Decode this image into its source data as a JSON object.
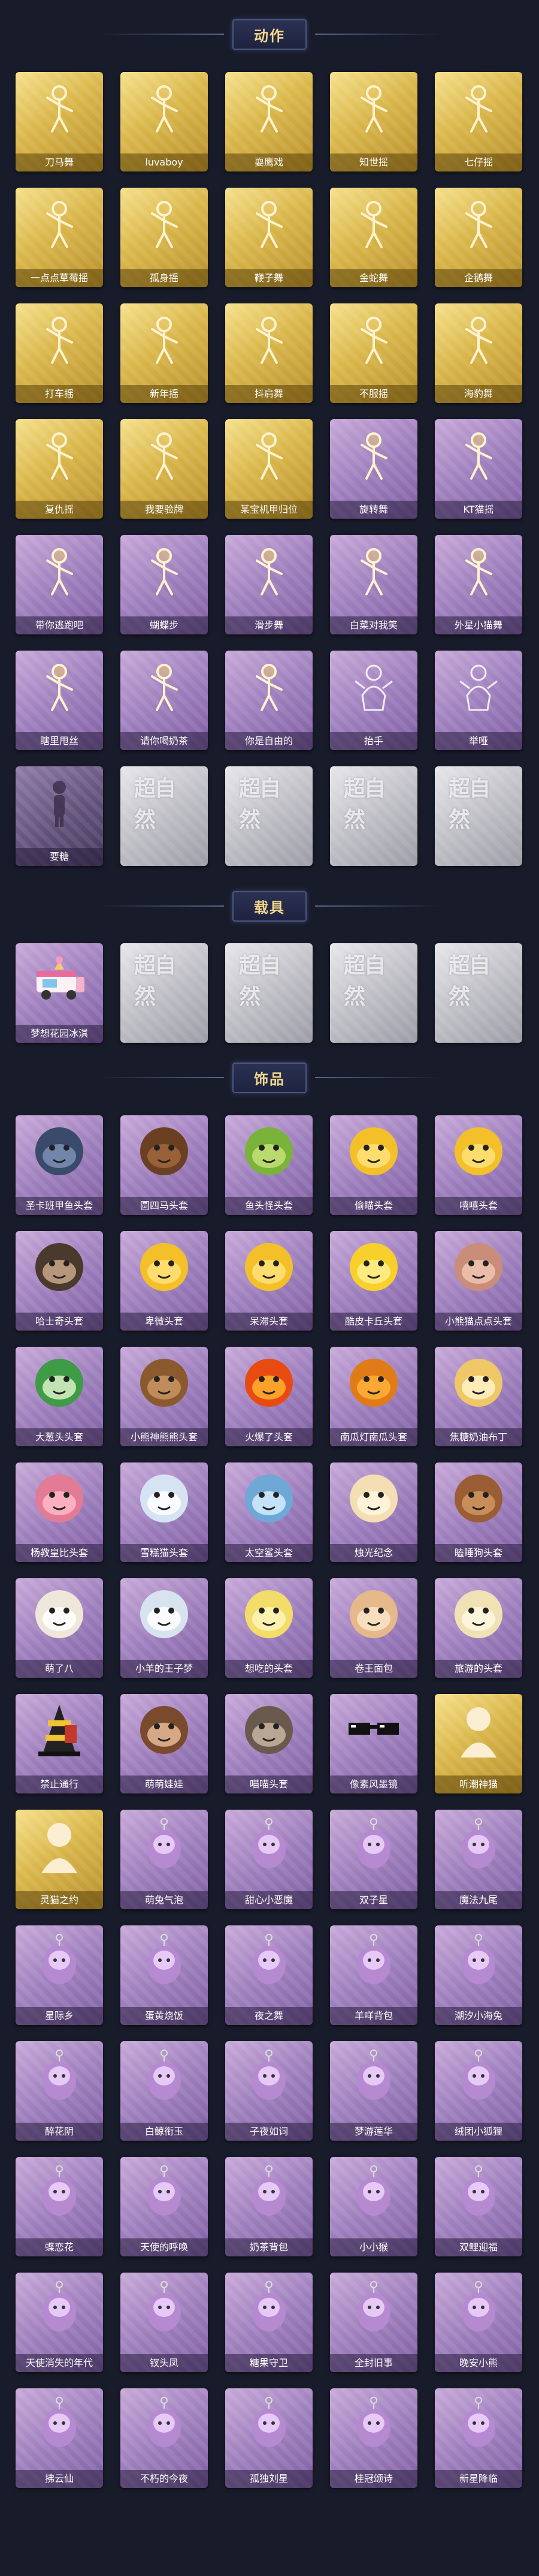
{
  "sections": [
    {
      "title": "动作",
      "items": [
        {
          "label": "刀马舞",
          "rarity": "gold",
          "icon": "dance-pose-icon"
        },
        {
          "label": "luvaboy",
          "rarity": "gold",
          "icon": "dance-pose-icon"
        },
        {
          "label": "耍鹰戏",
          "rarity": "gold",
          "icon": "dance-pose-icon"
        },
        {
          "label": "知世摇",
          "rarity": "gold",
          "icon": "dance-pose-icon"
        },
        {
          "label": "七仔摇",
          "rarity": "gold",
          "icon": "dance-pose-icon"
        },
        {
          "label": "一点点草莓摇",
          "rarity": "gold",
          "icon": "dance-pose-icon"
        },
        {
          "label": "孤身摇",
          "rarity": "gold",
          "icon": "dance-pose-icon"
        },
        {
          "label": "鞭子舞",
          "rarity": "gold",
          "icon": "dance-pose-icon"
        },
        {
          "label": "金蛇舞",
          "rarity": "gold",
          "icon": "dance-pose-icon"
        },
        {
          "label": "企鹅舞",
          "rarity": "gold",
          "icon": "dance-pose-icon"
        },
        {
          "label": "打车摇",
          "rarity": "gold",
          "icon": "dance-pose-icon"
        },
        {
          "label": "新年摇",
          "rarity": "gold",
          "icon": "dance-pose-icon"
        },
        {
          "label": "抖肩舞",
          "rarity": "gold",
          "icon": "dance-pose-icon"
        },
        {
          "label": "不服摇",
          "rarity": "gold",
          "icon": "dance-pose-icon"
        },
        {
          "label": "海豹舞",
          "rarity": "gold",
          "icon": "dance-pose-icon"
        },
        {
          "label": "复仇摇",
          "rarity": "gold",
          "icon": "dance-pose-icon"
        },
        {
          "label": "我要验牌",
          "rarity": "gold",
          "icon": "dance-pose-icon"
        },
        {
          "label": "某宝机甲归位",
          "rarity": "gold",
          "icon": "dance-pose-icon"
        },
        {
          "label": "旋转舞",
          "rarity": "purple",
          "icon": "dance-pose-icon"
        },
        {
          "label": "KT猫摇",
          "rarity": "purple",
          "icon": "dance-pose-icon"
        },
        {
          "label": "带你逃跑吧",
          "rarity": "purple",
          "icon": "dance-pose-icon"
        },
        {
          "label": "蝴蝶步",
          "rarity": "purple",
          "icon": "dance-pose-icon"
        },
        {
          "label": "滑步舞",
          "rarity": "purple",
          "icon": "dance-pose-icon"
        },
        {
          "label": "白菜对我笑",
          "rarity": "purple",
          "icon": "dance-pose-icon"
        },
        {
          "label": "外星小猫舞",
          "rarity": "purple",
          "icon": "dance-pose-icon"
        },
        {
          "label": "瞎里甩丝",
          "rarity": "purple",
          "icon": "dance-pose-icon"
        },
        {
          "label": "请你喝奶茶",
          "rarity": "purple",
          "icon": "dance-pose-icon"
        },
        {
          "label": "你是自由的",
          "rarity": "purple",
          "icon": "dance-pose-icon"
        },
        {
          "label": "抬手",
          "rarity": "purple",
          "icon": "ghost-pose-icon"
        },
        {
          "label": "举哑",
          "rarity": "purple",
          "icon": "ghost-pose-icon"
        },
        {
          "label": "要糖",
          "rarity": "dark",
          "icon": "silhouette-icon"
        },
        {
          "label": "",
          "rarity": "silver",
          "icon": "watermark-placeholder",
          "watermark": "超自然"
        },
        {
          "label": "",
          "rarity": "silver",
          "icon": "watermark-placeholder",
          "watermark": "超自然"
        },
        {
          "label": "",
          "rarity": "silver",
          "icon": "watermark-placeholder",
          "watermark": "超自然"
        },
        {
          "label": "",
          "rarity": "silver",
          "icon": "watermark-placeholder",
          "watermark": "超自然"
        }
      ]
    },
    {
      "title": "载具",
      "items": [
        {
          "label": "梦想花园冰淇",
          "rarity": "purple",
          "icon": "ice-cream-truck-icon"
        },
        {
          "label": "",
          "rarity": "silver",
          "icon": "watermark-placeholder",
          "watermark": "超自然"
        },
        {
          "label": "",
          "rarity": "silver",
          "icon": "watermark-placeholder",
          "watermark": "超自然"
        },
        {
          "label": "",
          "rarity": "silver",
          "icon": "watermark-placeholder",
          "watermark": "超自然"
        },
        {
          "label": "",
          "rarity": "silver",
          "icon": "watermark-placeholder",
          "watermark": "超自然"
        }
      ]
    },
    {
      "title": "饰品",
      "items": [
        {
          "label": "圣卡班甲鱼头套",
          "rarity": "purple",
          "icon": "seal-head-icon"
        },
        {
          "label": "圆四马头套",
          "rarity": "purple",
          "icon": "horse-head-icon"
        },
        {
          "label": "鱼头怪头套",
          "rarity": "purple",
          "icon": "fish-head-icon"
        },
        {
          "label": "偷瞄头套",
          "rarity": "purple",
          "icon": "smile-emoji-icon"
        },
        {
          "label": "嘻嘻头套",
          "rarity": "purple",
          "icon": "grin-emoji-icon"
        },
        {
          "label": "哈士奇头套",
          "rarity": "purple",
          "icon": "husky-head-icon"
        },
        {
          "label": "卑微头套",
          "rarity": "purple",
          "icon": "sad-emoji-icon"
        },
        {
          "label": "呆滞头套",
          "rarity": "purple",
          "icon": "blank-emoji-icon"
        },
        {
          "label": "酷皮卡丘头套",
          "rarity": "purple",
          "icon": "pikachu-head-icon"
        },
        {
          "label": "小熊猫点点头套",
          "rarity": "purple",
          "icon": "critter-head-icon"
        },
        {
          "label": "大葱头头套",
          "rarity": "purple",
          "icon": "bokchoy-head-icon"
        },
        {
          "label": "小熊神熊熊头套",
          "rarity": "purple",
          "icon": "bear-head-icon"
        },
        {
          "label": "火爆了头套",
          "rarity": "purple",
          "icon": "fire-head-icon"
        },
        {
          "label": "南瓜灯南瓜头套",
          "rarity": "purple",
          "icon": "pumpkin-head-icon"
        },
        {
          "label": "焦糖奶油布丁",
          "rarity": "purple",
          "icon": "pudding-head-icon"
        },
        {
          "label": "杨教皇比头套",
          "rarity": "purple",
          "icon": "pig-head-icon"
        },
        {
          "label": "雪糕猫头套",
          "rarity": "purple",
          "icon": "snow-cat-head-icon"
        },
        {
          "label": "太空鲨头套",
          "rarity": "purple",
          "icon": "shark-head-icon"
        },
        {
          "label": "烛光纪念",
          "rarity": "purple",
          "icon": "candle-head-icon"
        },
        {
          "label": "瞌睡狗头套",
          "rarity": "purple",
          "icon": "dog-head-icon"
        },
        {
          "label": "萌了八",
          "rarity": "purple",
          "icon": "dumpling-head-icon"
        },
        {
          "label": "小羊的王子梦",
          "rarity": "purple",
          "icon": "sheep-head-icon"
        },
        {
          "label": "想吃的头套",
          "rarity": "purple",
          "icon": "duck-head-icon"
        },
        {
          "label": "卷王面包",
          "rarity": "purple",
          "icon": "bread-head-icon"
        },
        {
          "label": "旅游的头套",
          "rarity": "purple",
          "icon": "chick-head-icon"
        },
        {
          "label": "禁止通行",
          "rarity": "purple",
          "icon": "traffic-cone-icon"
        },
        {
          "label": "萌萌娃娃",
          "rarity": "purple",
          "icon": "doll-head-icon"
        },
        {
          "label": "喵喵头套",
          "rarity": "purple",
          "icon": "cat-head-icon"
        },
        {
          "label": "像素风墨镜",
          "rarity": "purple",
          "icon": "pixel-glasses-icon"
        },
        {
          "label": "听潮神猫",
          "rarity": "gold",
          "icon": "avatar-silhouette-icon"
        },
        {
          "label": "灵猫之约",
          "rarity": "gold",
          "icon": "avatar-silhouette-icon"
        },
        {
          "label": "萌兔气泡",
          "rarity": "purple",
          "icon": "bunny-charm-icon"
        },
        {
          "label": "甜心小恶魔",
          "rarity": "purple",
          "icon": "devil-charm-icon"
        },
        {
          "label": "双子星",
          "rarity": "purple",
          "icon": "planet-charm-icon"
        },
        {
          "label": "魔法九尾",
          "rarity": "purple",
          "icon": "fox-charm-icon"
        },
        {
          "label": "星际乡",
          "rarity": "purple",
          "icon": "star-charm-icon"
        },
        {
          "label": "蛋黄烧饭",
          "rarity": "purple",
          "icon": "egg-charm-icon"
        },
        {
          "label": "夜之舞",
          "rarity": "purple",
          "icon": "crystal-charm-icon"
        },
        {
          "label": "羊咩背包",
          "rarity": "purple",
          "icon": "lamb-charm-icon"
        },
        {
          "label": "潮汐小海兔",
          "rarity": "purple",
          "icon": "blue-cat-charm-icon"
        },
        {
          "label": "醉花阴",
          "rarity": "purple",
          "icon": "flower-charm-icon"
        },
        {
          "label": "白鲸衔玉",
          "rarity": "purple",
          "icon": "whale-charm-icon"
        },
        {
          "label": "子夜如词",
          "rarity": "purple",
          "icon": "doll-charm-icon"
        },
        {
          "label": "梦游莲华",
          "rarity": "purple",
          "icon": "lotus-charm-icon"
        },
        {
          "label": "绒团小狐狸",
          "rarity": "purple",
          "icon": "fox-charm-icon"
        },
        {
          "label": "蝶恋花",
          "rarity": "purple",
          "icon": "butterfly-charm-icon"
        },
        {
          "label": "天使的呼唤",
          "rarity": "purple",
          "icon": "angel-charm-icon"
        },
        {
          "label": "奶茶背包",
          "rarity": "purple",
          "icon": "milktea-charm-icon"
        },
        {
          "label": "小小猴",
          "rarity": "purple",
          "icon": "monkey-charm-icon"
        },
        {
          "label": "双鲤迎福",
          "rarity": "purple",
          "icon": "koi-charm-icon"
        },
        {
          "label": "天使消失的年代",
          "rarity": "purple",
          "icon": "wing-charm-icon"
        },
        {
          "label": "钗头凤",
          "rarity": "purple",
          "icon": "phoenix-charm-icon"
        },
        {
          "label": "糖果守卫",
          "rarity": "purple",
          "icon": "candy-charm-icon"
        },
        {
          "label": "全封旧事",
          "rarity": "purple",
          "icon": "knight-charm-icon"
        },
        {
          "label": "晚安小熊",
          "rarity": "purple",
          "icon": "bear-charm-icon"
        },
        {
          "label": "拂云仙",
          "rarity": "purple",
          "icon": "cloud-charm-icon"
        },
        {
          "label": "不朽的今夜",
          "rarity": "purple",
          "icon": "rose-charm-icon"
        },
        {
          "label": "孤独刘星",
          "rarity": "purple",
          "icon": "star-charm-icon"
        },
        {
          "label": "桂冠颂诗",
          "rarity": "purple",
          "icon": "laurel-charm-icon"
        },
        {
          "label": "新星降临",
          "rarity": "purple",
          "icon": "nova-charm-icon"
        }
      ]
    }
  ]
}
